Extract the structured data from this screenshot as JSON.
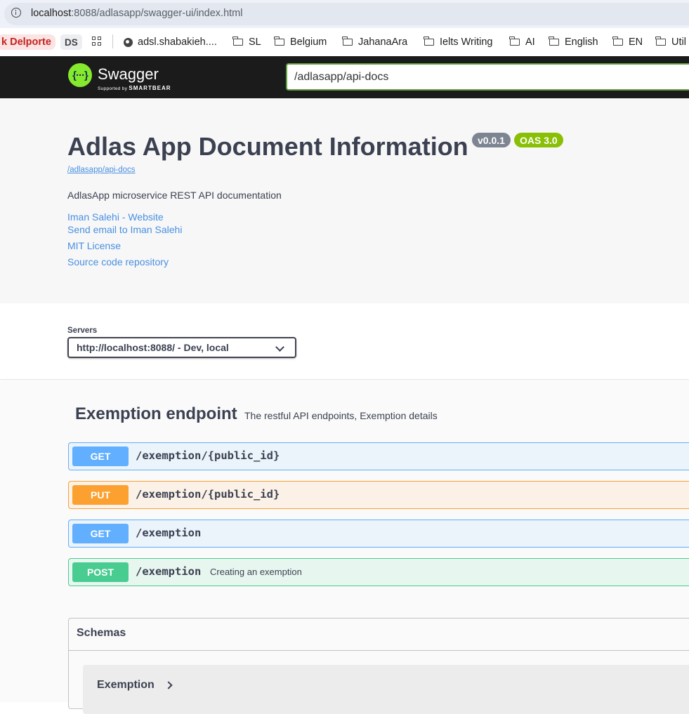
{
  "browser": {
    "url_host": "localhost",
    "url_rest": ":8088/adlasapp/swagger-ui/index.html",
    "bookmarks": {
      "red_chip": "k Delporte",
      "ds_chip": "DS",
      "site": "adsl.shabakieh....",
      "folders": [
        "SL",
        "Belgium",
        "JahanaAra",
        "Ielts Writing",
        "AI",
        "English",
        "EN",
        "Util"
      ]
    }
  },
  "topbar": {
    "logo_text": "Swagger",
    "logo_sub": "Supported by",
    "logo_sub_brand": "SMARTBEAR",
    "logo_mark": "{···}",
    "api_url": "/adlasapp/api-docs"
  },
  "info": {
    "title": "Adlas App Document Information",
    "version": "v0.0.1",
    "oas": "OAS 3.0",
    "base_url": "/adlasapp/api-docs",
    "description": "AdlasApp microservice REST API documentation",
    "links": [
      "Iman Salehi - Website",
      "Send email to Iman Salehi",
      "MIT License",
      "Source code repository"
    ]
  },
  "servers": {
    "label": "Servers",
    "selected": "http://localhost:8088/ - Dev, local"
  },
  "tag": {
    "name": "Exemption endpoint",
    "description": "The restful API endpoints, Exemption details"
  },
  "operations": [
    {
      "method": "GET",
      "path": "/exemption/{public_id}",
      "summary": ""
    },
    {
      "method": "PUT",
      "path": "/exemption/{public_id}",
      "summary": ""
    },
    {
      "method": "GET",
      "path": "/exemption",
      "summary": ""
    },
    {
      "method": "POST",
      "path": "/exemption",
      "summary": "Creating an exemption"
    }
  ],
  "schemas": {
    "title": "Schemas",
    "models": [
      "Exemption"
    ]
  }
}
